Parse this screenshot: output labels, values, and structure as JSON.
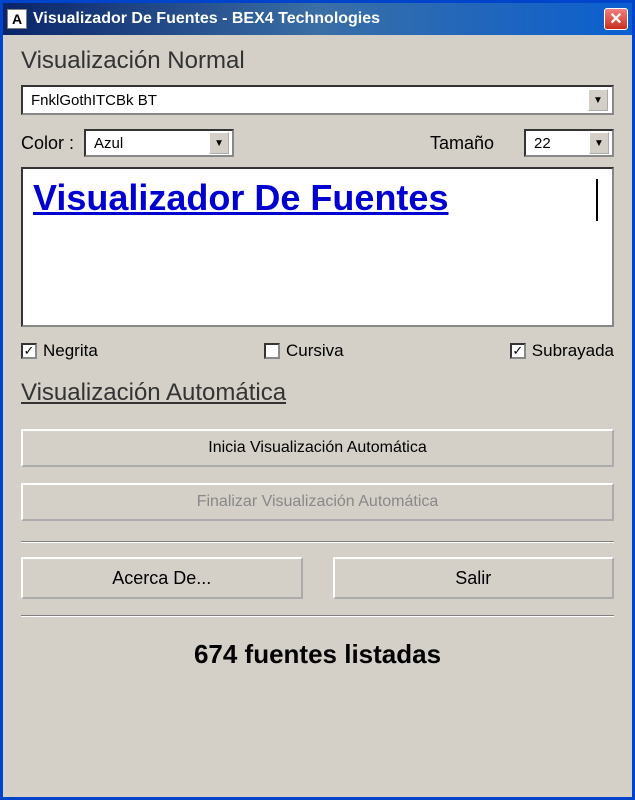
{
  "titlebar": {
    "icon_letter": "A",
    "title": "Visualizador De Fuentes - BEX4 Technologies"
  },
  "section_normal": "Visualización Normal",
  "font_selected": "FnklGothITCBk BT",
  "color_label": "Color :",
  "color_value": "Azul",
  "size_label": "Tamaño",
  "size_value": "22",
  "preview_text": "Visualizador De Fuentes",
  "checks": {
    "bold": {
      "label": "Negrita",
      "checked": "✓"
    },
    "italic": {
      "label": "Cursiva",
      "checked": ""
    },
    "underline": {
      "label": "Subrayada",
      "checked": "✓"
    }
  },
  "section_auto": "Visualización Automática",
  "btn_start": "Inicia Visualización Automática",
  "btn_stop": "Finalizar Visualización Automática",
  "btn_about": "Acerca De...",
  "btn_exit": "Salir",
  "status": "674 fuentes listadas"
}
